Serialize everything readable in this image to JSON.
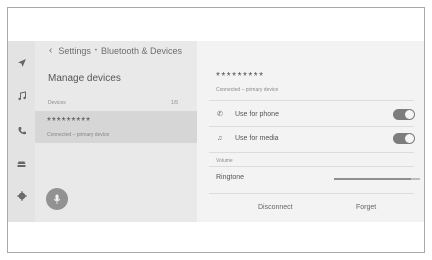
{
  "breadcrumb": {
    "back_icon": "chevron-left-icon",
    "parent": "Settings",
    "separator": "•",
    "current": "Bluetooth & Devices"
  },
  "sidebar": {
    "title": "Manage devices",
    "list_header": {
      "label": "Devices",
      "count": "1/5"
    },
    "devices": [
      {
        "name": "*********",
        "status": "Connected – primary device",
        "selected": true
      }
    ]
  },
  "rail": {
    "icons": [
      "navigation-icon",
      "music-icon",
      "phone-icon",
      "car-icon",
      "settings-icon"
    ]
  },
  "mic": {
    "icon": "microphone-icon"
  },
  "detail": {
    "device_name": "*********",
    "device_status": "Connected – primary device",
    "options": [
      {
        "icon": "phone-icon",
        "label": "Use for phone",
        "enabled": true
      },
      {
        "icon": "music-note-icon",
        "label": "Use for media",
        "enabled": true
      }
    ],
    "volume_label": "Volume",
    "ringtone_label": "Ringtone",
    "ringtone_level": 0.9,
    "disconnect_label": "Disconnect",
    "forget_label": "Forget"
  },
  "colors": {
    "screen_bg": "#eeeeee",
    "toggle_on": "#7d7d7d",
    "selected_row": "#d6d6d6"
  }
}
